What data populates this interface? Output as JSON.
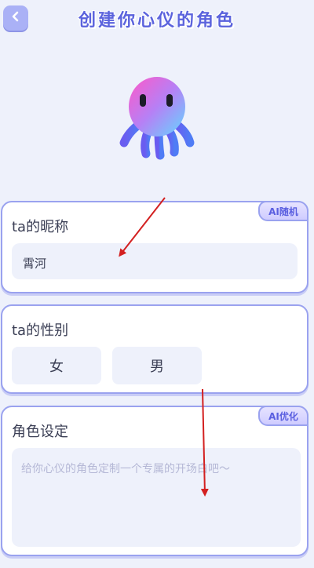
{
  "header": {
    "title": "创建你心仪的角色",
    "back_icon": "chevron-left-icon"
  },
  "mascot": {
    "icon": "octopus-mascot-icon"
  },
  "nickname_card": {
    "label": "ta的昵称",
    "value": "霄河",
    "ai_badge": "AI随机"
  },
  "gender_card": {
    "label": "ta的性别",
    "options": [
      "女",
      "男"
    ]
  },
  "role_card": {
    "label": "角色设定",
    "placeholder": "给你心仪的角色定制一个专属的开场白吧～",
    "ai_badge": "AI优化"
  },
  "colors": {
    "accent": "#5b63dd",
    "card_border": "#9aa2ef",
    "field_bg": "#eef1fb",
    "annotation_arrow": "#d32020"
  }
}
